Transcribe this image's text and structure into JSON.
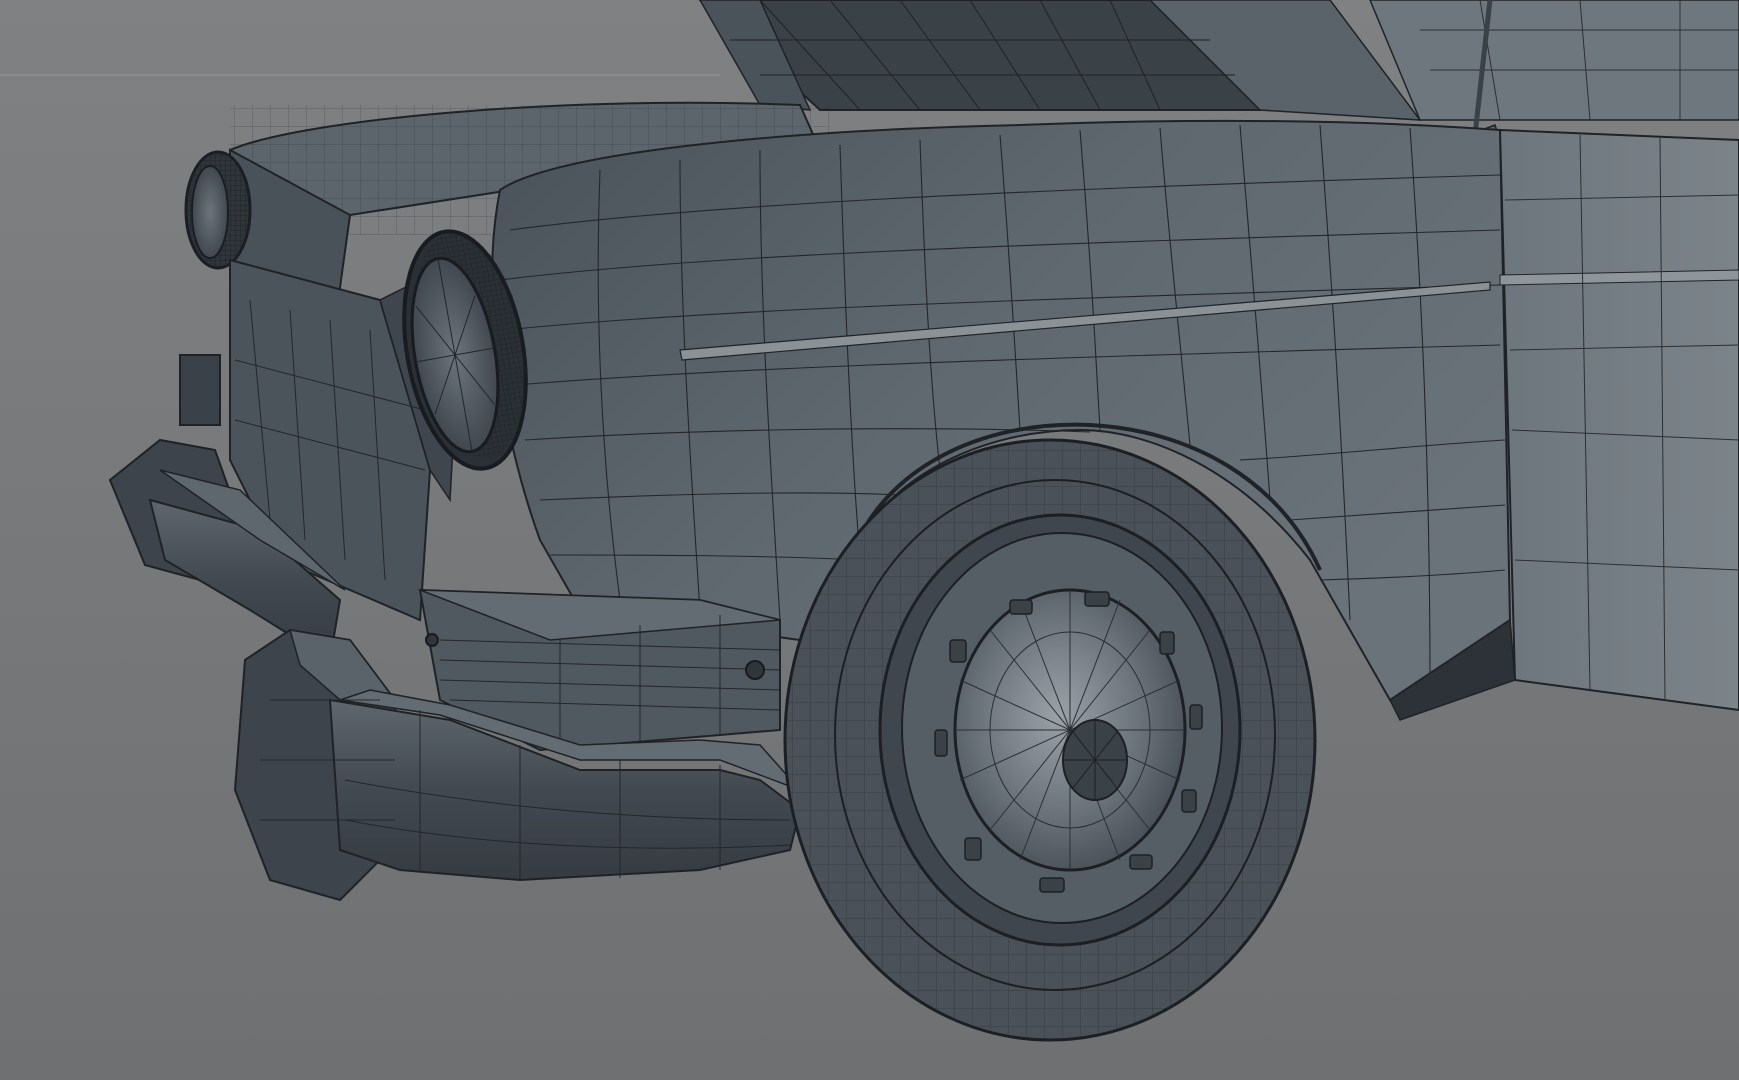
{
  "viewport": {
    "background_top": "#7f8183",
    "background_bottom": "#6e7072",
    "horizon_line": "#8a8c8e"
  },
  "model": {
    "subject": "car-front-wireframe",
    "shading": "grey-shaded-with-wireframe",
    "colors": {
      "body_light": "#6a7178",
      "body_mid": "#566068",
      "body_dark": "#3d444b",
      "body_deep": "#2c3238",
      "wire": "#1f2327",
      "bumper_top": "#5d656d",
      "bumper_face": "#3a4148",
      "tire": "#4c535a",
      "hubcap": "#7b8289"
    }
  }
}
